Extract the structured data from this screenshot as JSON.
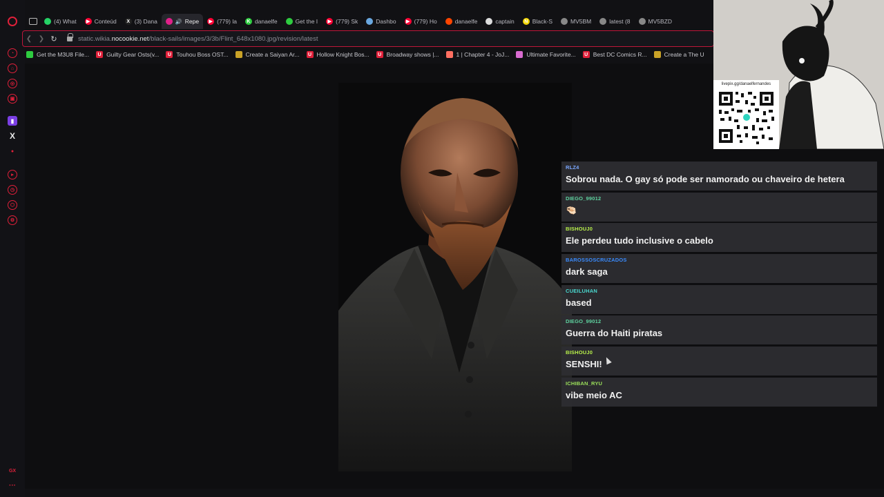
{
  "tabs": [
    {
      "label": "(4) What",
      "fav_color": "#25d366",
      "fav_glyph": ""
    },
    {
      "label": "Conteúd",
      "fav_color": "#ff0033",
      "fav_glyph": "▶"
    },
    {
      "label": "(3) Dana",
      "fav_color": "#222222",
      "fav_glyph": "X"
    },
    {
      "label": "Repe",
      "fav_color": "#e0208a",
      "fav_glyph": "",
      "active": true
    },
    {
      "label": "(779) la",
      "fav_color": "#ff0033",
      "fav_glyph": "▶"
    },
    {
      "label": "danaelfe",
      "fav_color": "#2ecc40",
      "fav_glyph": "K"
    },
    {
      "label": "Get the I",
      "fav_color": "#2ecc40",
      "fav_glyph": ""
    },
    {
      "label": "(779) Sk",
      "fav_color": "#ff0033",
      "fav_glyph": "▶"
    },
    {
      "label": "Dashbo",
      "fav_color": "#6aa8e0",
      "fav_glyph": ""
    },
    {
      "label": "(779) Ho",
      "fav_color": "#ff0033",
      "fav_glyph": "▶"
    },
    {
      "label": "danaelfe",
      "fav_color": "#ff4500",
      "fav_glyph": ""
    },
    {
      "label": "captain",
      "fav_color": "#dddddd",
      "fav_glyph": ""
    },
    {
      "label": "Black-S",
      "fav_color": "#f2d600",
      "fav_glyph": "N"
    },
    {
      "label": "MV5BM",
      "fav_color": "#888888",
      "fav_glyph": ""
    },
    {
      "label": "latest (8",
      "fav_color": "#888888",
      "fav_glyph": ""
    },
    {
      "label": "MV5BZD",
      "fav_color": "#888888",
      "fav_glyph": ""
    }
  ],
  "address": {
    "prefix": "static.wikia.",
    "domain": "nocookie.net",
    "path": "/black-sails/images/3/3b/Flint_648x1080.jpg/revision/latest"
  },
  "bookmarks": [
    {
      "label": "Get the M3U8 File...",
      "fav_color": "#2ecc40",
      "fav_glyph": ""
    },
    {
      "label": "Guilty Gear Osts(v...",
      "fav_color": "#e0203a",
      "fav_glyph": "U"
    },
    {
      "label": "Touhou Boss OST...",
      "fav_color": "#e0203a",
      "fav_glyph": "U"
    },
    {
      "label": "Create a Saiyan Ar...",
      "fav_color": "#c9a227",
      "fav_glyph": ""
    },
    {
      "label": "Hollow Knight Bos...",
      "fav_color": "#e0203a",
      "fav_glyph": "U"
    },
    {
      "label": "Broadway shows |...",
      "fav_color": "#e0203a",
      "fav_glyph": "U"
    },
    {
      "label": "1 | Chapter 4 - JoJ...",
      "fav_color": "#ff6f61",
      "fav_glyph": ""
    },
    {
      "label": "Ultimate Favorite...",
      "fav_color": "#d86bd0",
      "fav_glyph": ""
    },
    {
      "label": "Best DC Comics R...",
      "fav_color": "#e0203a",
      "fav_glyph": "U"
    },
    {
      "label": "Create a The U",
      "fav_color": "#c9a227",
      "fav_glyph": ""
    }
  ],
  "chat": [
    {
      "user": "RLZ4",
      "user_color": "#7aa7ff",
      "text": "Sobrou nada. O gay só pode ser namorado ou chaveiro de hetera"
    },
    {
      "user": "DIEGO_99012",
      "user_color": "#5fd3a0",
      "text": "🤏🏻"
    },
    {
      "user": "BISHOUJ0",
      "user_color": "#b8f04a",
      "text": "Ele perdeu tudo inclusive o cabelo"
    },
    {
      "user": "BAROSSOSCRUZADOS",
      "user_color": "#3a8cff",
      "text": "dark saga"
    },
    {
      "user": "CUEILUHAN",
      "user_color": "#4ad9d0",
      "text": "based"
    },
    {
      "user": "DIEGO_99012",
      "user_color": "#5fd3a0",
      "text": "Guerra do Haiti piratas"
    },
    {
      "user": "BISHOUJ0",
      "user_color": "#b8f04a",
      "text": "SENSHI!"
    },
    {
      "user": "ICHIBAN_RYU",
      "user_color": "#9be05a",
      "text": "vibe meio AC"
    }
  ],
  "webcam": {
    "qr_url": "livepix.gg/danaelfernandes"
  },
  "sidebar": {
    "gx_label": "GX",
    "dots_label": "···"
  }
}
